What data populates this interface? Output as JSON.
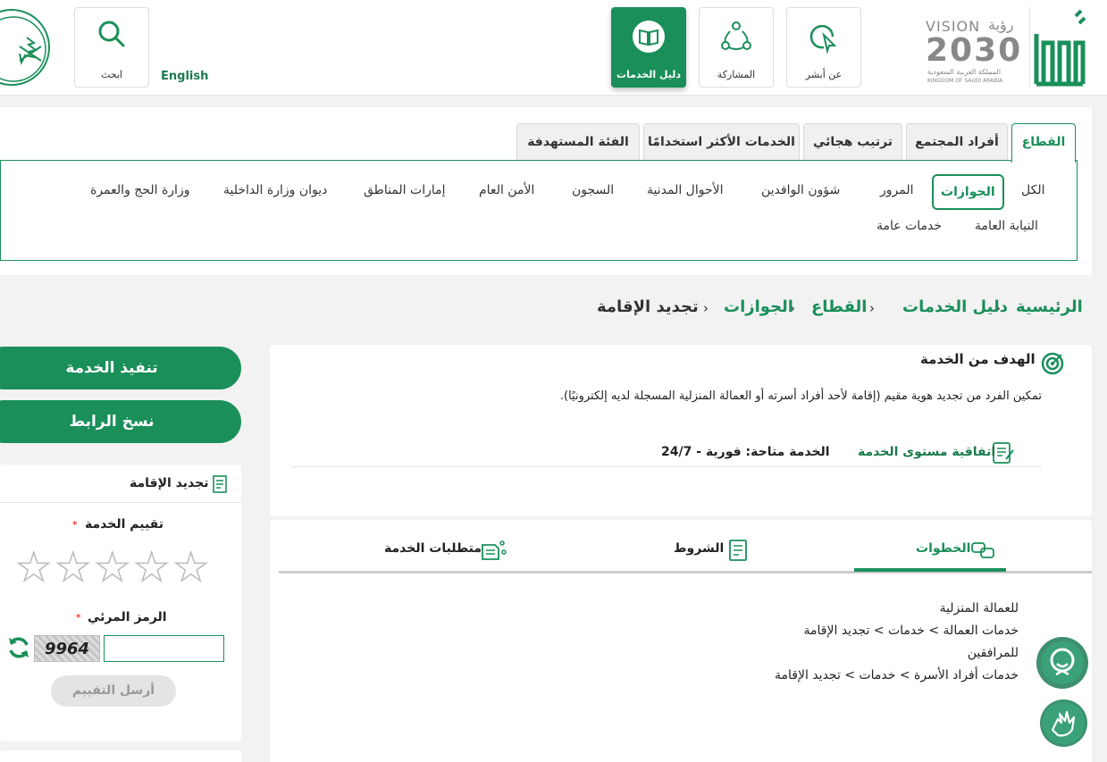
{
  "header": {
    "search_label": "ابحث",
    "english_label": "English",
    "nav": [
      {
        "label": "دليل الخدمات",
        "icon": "book-icon",
        "active": true
      },
      {
        "label": "المشاركة",
        "icon": "share-network-icon",
        "active": false
      },
      {
        "label": "عن أبشر",
        "icon": "cursor-click-icon",
        "active": false
      }
    ],
    "vision": {
      "brand": "VISION",
      "brand_ar": "رؤية",
      "year": "2030",
      "kingdom_ar": "المملكة العربية السعودية",
      "kingdom_en": "KINGDOM OF SAUDI ARABIA"
    }
  },
  "sector_tabs": [
    "القطاع",
    "أفراد المجتمع",
    "ترتيب هجائي",
    "الخدمات الأكثر استخدامًا",
    "الفئة المستهدفة"
  ],
  "sector_items_row1": [
    "الكل",
    "الجوازات",
    "المرور",
    "شؤون الوافدين",
    "الأحوال المدنية",
    "السجون",
    "الأمن العام",
    "إمارات المناطق",
    "ديوان وزارة الداخلية",
    "وزارة الحج والعمرة"
  ],
  "sector_items_row2": [
    "النيابة العامة",
    "خدمات عامة"
  ],
  "breadcrumb": [
    "الرئيسية",
    "دليل الخدمات",
    "القطاع",
    "الجوازات",
    "تجديد الإقامة"
  ],
  "goal": {
    "title": "الهدف من الخدمة",
    "description": "تمكين الفرد من تجديد هوية مقيم (إقامة لأحد أفراد أسرته أو العمالة المنزلية المسجلة لديه إلكترونيًا).",
    "sla_label": "اتفاقية مستوى الخدمة",
    "availability_label": "الخدمة متاحة: فورية - 24/7"
  },
  "content_tabs": [
    "الخطوات",
    "الشروط",
    "متطلبات الخدمة"
  ],
  "steps": [
    "للعمالة المنزلية",
    "خدمات العمالة > خدمات > تجديد الإقامة",
    "للمرافقين",
    "خدمات أفراد الأسرة > خدمات > تجديد الإقامة"
  ],
  "actions": {
    "execute": "تنفيذ الخدمة",
    "copy_link": "نسخ الرابط"
  },
  "rating": {
    "title": "تجديد الإقامة",
    "rate_label": "تقييم الخدمة",
    "captcha_label": "الرمز المرئي",
    "captcha_value": "9964",
    "required_mark": "*",
    "submit_label": "أرسل التقييم",
    "stars": 5
  },
  "colors": {
    "brand": "#1a8f5a",
    "brand_dark": "#1a7a4c"
  }
}
